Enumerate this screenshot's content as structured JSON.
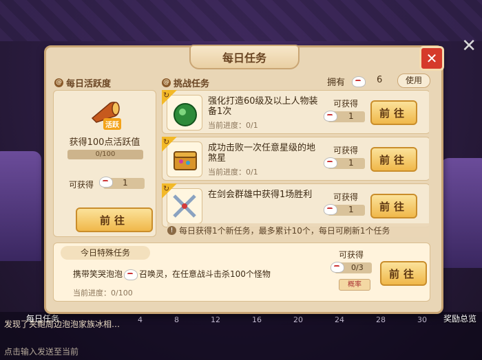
{
  "dialog": {
    "title": "每日任务",
    "close_label": "✕"
  },
  "activity": {
    "section_title": "每日活跃度",
    "reward_text": "获得100点活跃值",
    "progress": "0/100",
    "obtain_label": "可获得",
    "obtain_count": "1",
    "go_label": "前往",
    "horn_badge": "活跃"
  },
  "challenge": {
    "section_title": "挑战任务",
    "own_label": "拥有",
    "own_count": "6",
    "use_label": "使用",
    "tasks": [
      {
        "name": "强化打造60级及以上人物装备1次",
        "progress": "当前进度：0/1",
        "obtain_label": "可获得",
        "count": "1",
        "go_label": "前往",
        "icon": "green-orb-icon"
      },
      {
        "name": "成功击败一次任意星级的地煞星",
        "progress": "当前进度：0/1",
        "obtain_label": "可获得",
        "count": "1",
        "go_label": "前往",
        "icon": "treasure-chest-icon"
      },
      {
        "name": "在剑会群雄中获得1场胜利",
        "progress": "",
        "obtain_label": "可获得",
        "count": "1",
        "go_label": "前往",
        "icon": "crossed-swords-icon"
      }
    ],
    "notice": "每日获得1个新任务，最多累计10个，每日可刷新1个任务"
  },
  "special": {
    "tag": "今日特殊任务",
    "desc_prefix": "携带笑哭泡泡",
    "desc_suffix": "召唤灵，在任意战斗击杀100个怪物",
    "progress": "当前进度：0/100",
    "obtain_label": "可获得",
    "count": "0/3",
    "probability_label": "概率",
    "go_label": "前往"
  },
  "background": {
    "left_label": "每日任务",
    "right_label": "奖励总览",
    "ticks": [
      "4",
      "8",
      "12",
      "16",
      "20",
      "24",
      "28",
      "30"
    ],
    "chat_line_top": "发现了夹鲍周边泡泡家族冰相…",
    "chat_line_bottom": "点击输入发送至当前"
  },
  "colors": {
    "panel": "#e9d6b6",
    "accent_button": "#f0b84a",
    "close": "#d53a2a"
  }
}
